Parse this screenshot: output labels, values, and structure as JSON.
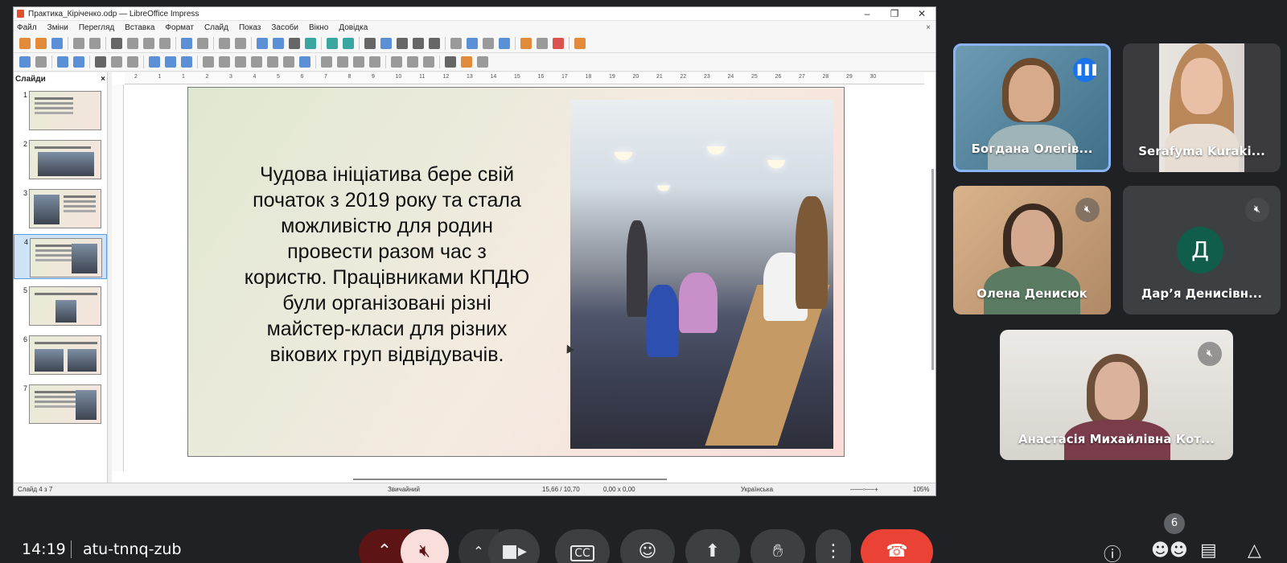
{
  "app": {
    "title": "Практика_Кіріченко.odp — LibreOffice Impress",
    "menu": [
      "Файл",
      "Зміни",
      "Перегляд",
      "Вставка",
      "Формат",
      "Слайд",
      "Показ",
      "Засоби",
      "Вікно",
      "Довідка"
    ]
  },
  "slides_pane": {
    "title": "Слайди",
    "close": "×",
    "items": [
      {
        "num": "1",
        "selected": false
      },
      {
        "num": "2",
        "selected": false
      },
      {
        "num": "3",
        "selected": false
      },
      {
        "num": "4",
        "selected": true
      },
      {
        "num": "5",
        "selected": false
      },
      {
        "num": "6",
        "selected": false
      },
      {
        "num": "7",
        "selected": false
      }
    ]
  },
  "ruler": [
    "2",
    "1",
    "1",
    "2",
    "3",
    "4",
    "5",
    "6",
    "7",
    "8",
    "9",
    "10",
    "11",
    "12",
    "13",
    "14",
    "15",
    "16",
    "17",
    "18",
    "19",
    "20",
    "21",
    "22",
    "23",
    "24",
    "25",
    "26",
    "27",
    "28",
    "29",
    "30"
  ],
  "slide": {
    "text": "Чудова ініціатива бере свій\nпочаток з 2019 року та стала\nможливістю для родин\nпровести разом час з\nкористю. Працівниками КПДЮ\nбули організовані різні\nмайстер-класи для різних\nвікових груп відвідувачів."
  },
  "status": {
    "slide": "Слайд 4 з 7",
    "layout": "Звичайний",
    "position": "15,66 / 10,70",
    "size": "0,00 x 0,00",
    "language": "Українська",
    "zoom": "105%"
  },
  "participants": {
    "bogdana": "Богдана Олегів...",
    "serafyma": "Serafyma Kuraki...",
    "olena": "Олена Денисюк",
    "darya": "Дар’я Денисівн...",
    "darya_initial": "Д",
    "anastasia": "Анастасія Михайлівна Кот..."
  },
  "meeting": {
    "time": "14:19",
    "code": "atu-tnnq-zub",
    "people_count": "6"
  },
  "colors": {
    "active_speaker": "#8ab4f8",
    "leave": "#ea4335",
    "avatar": "#0f5d4a"
  },
  "icons": [
    "mic-off-icon",
    "camera-icon",
    "captions-icon",
    "emoji-icon",
    "present-icon",
    "hand-icon",
    "more-icon",
    "leave-icon",
    "info-icon",
    "people-icon",
    "chat-icon",
    "activities-icon"
  ]
}
